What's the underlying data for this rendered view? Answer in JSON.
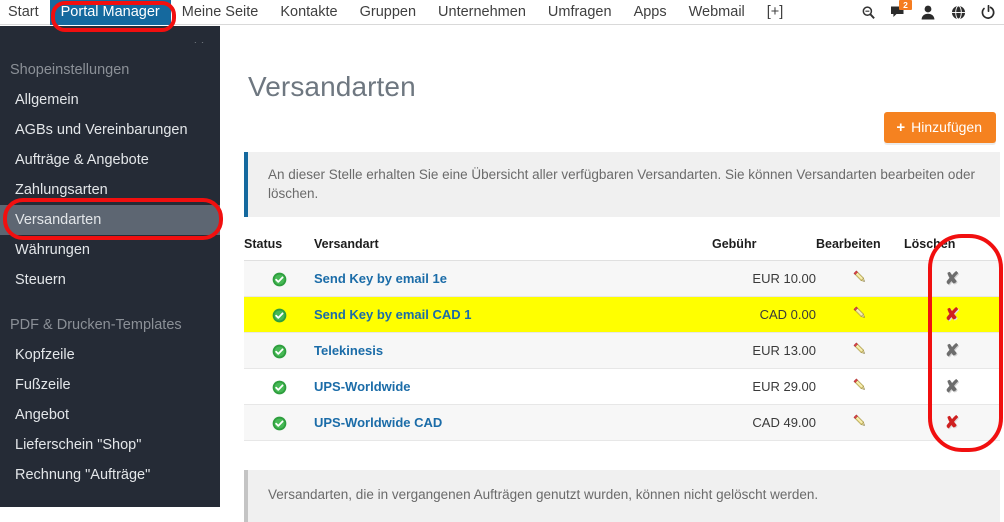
{
  "topnav": {
    "items": [
      {
        "label": "Start",
        "active": false
      },
      {
        "label": "Portal Manager",
        "active": true
      },
      {
        "label": "Meine Seite",
        "active": false
      },
      {
        "label": "Kontakte",
        "active": false
      },
      {
        "label": "Gruppen",
        "active": false
      },
      {
        "label": "Unternehmen",
        "active": false
      },
      {
        "label": "Umfragen",
        "active": false
      },
      {
        "label": "Apps",
        "active": false
      },
      {
        "label": "Webmail",
        "active": false
      },
      {
        "label": "[+]",
        "active": false
      }
    ],
    "icons": [
      {
        "name": "search-icon"
      },
      {
        "name": "messages-icon",
        "badge": "2"
      },
      {
        "name": "user-icon"
      },
      {
        "name": "globe-icon"
      },
      {
        "name": "power-icon"
      }
    ],
    "active_tab_color": "#15699e"
  },
  "sidebar": {
    "close_label": "✕",
    "groups": [
      {
        "title": "Shopeinstellungen",
        "items": [
          {
            "label": "Allgemein",
            "selected": false
          },
          {
            "label": "AGBs und Vereinbarungen",
            "selected": false
          },
          {
            "label": "Aufträge & Angebote",
            "selected": false
          },
          {
            "label": "Zahlungsarten",
            "selected": false
          },
          {
            "label": "Versandarten",
            "selected": true
          },
          {
            "label": "Währungen",
            "selected": false
          },
          {
            "label": "Steuern",
            "selected": false
          }
        ]
      },
      {
        "title": "PDF & Drucken-Templates",
        "items": [
          {
            "label": "Kopfzeile",
            "selected": false
          },
          {
            "label": "Fußzeile",
            "selected": false
          },
          {
            "label": "Angebot",
            "selected": false
          },
          {
            "label": "Lieferschein \"Shop\"",
            "selected": false
          },
          {
            "label": "Rechnung \"Aufträge\"",
            "selected": false
          }
        ]
      }
    ],
    "background": "#252b36",
    "selected_background": "#5d6672"
  },
  "main": {
    "page_title": "Versandarten",
    "add_button": {
      "plus": "+",
      "label": "Hinzufügen",
      "color": "#f58220"
    },
    "info_top": "An dieser Stelle erhalten Sie eine Übersicht aller verfügbaren Versandarten. Sie können Versandarten bearbeiten oder löschen.",
    "info_bottom": "Versandarten, die in vergangenen Aufträgen genutzt wurden, können nicht gelöscht werden.",
    "table": {
      "headers": {
        "status": "Status",
        "name": "Versandart",
        "fee": "Gebühr",
        "edit": "Bearbeiten",
        "delete": "Löschen"
      },
      "rows": [
        {
          "status": "active",
          "name": "Send Key by email 1e",
          "fee": "EUR 10.00",
          "edit_icon": "pencil-icon",
          "delete_icon": "x-icon",
          "delete_color": "gray",
          "highlight": false,
          "stripe": "alt"
        },
        {
          "status": "active",
          "name": "Send Key by email CAD 1",
          "fee": "CAD 0.00",
          "edit_icon": "pencil-icon",
          "delete_icon": "x-icon",
          "delete_color": "red",
          "highlight": true,
          "stripe": "hl"
        },
        {
          "status": "active",
          "name": "Telekinesis",
          "fee": "EUR 13.00",
          "edit_icon": "pencil-icon",
          "delete_icon": "x-icon",
          "delete_color": "gray",
          "highlight": false,
          "stripe": "alt"
        },
        {
          "status": "active",
          "name": "UPS-Worldwide",
          "fee": "EUR 29.00",
          "edit_icon": "pencil-icon",
          "delete_icon": "x-icon",
          "delete_color": "gray",
          "highlight": false,
          "stripe": "plain"
        },
        {
          "status": "active",
          "name": "UPS-Worldwide CAD",
          "fee": "CAD 49.00",
          "edit_icon": "pencil-icon",
          "delete_icon": "x-icon",
          "delete_color": "red",
          "highlight": false,
          "stripe": "alt"
        }
      ]
    }
  },
  "annotations": {
    "color": "#f10f0f",
    "shapes": [
      "portal-manager-tab",
      "sidebar-versandarten-item",
      "loeschen-column"
    ]
  }
}
